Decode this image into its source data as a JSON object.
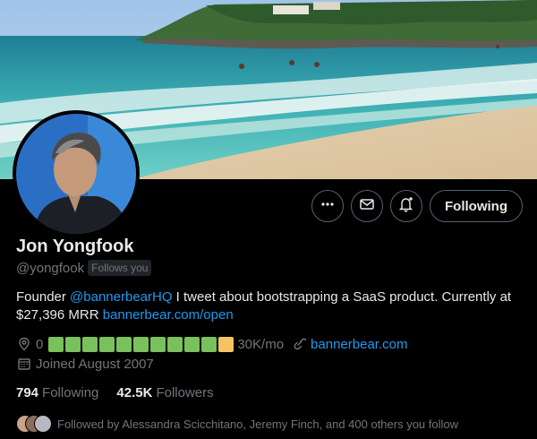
{
  "profile": {
    "name": "Jon Yongfook",
    "handle": "@yongfook",
    "follows_you_badge": "Follows you",
    "bio": {
      "part1": "Founder ",
      "mention": "@bannerbearHQ",
      "part2": " I tweet about bootstrapping a SaaS product. Currently at $27,396 MRR ",
      "link": "bannerbear.com/open"
    },
    "location": "0",
    "progress": {
      "filled_segments": 10,
      "partial_segments": 1,
      "total_segments": 11,
      "label": "30K/mo",
      "filled_color": "#7ac15b",
      "partial_color": "#f5c462"
    },
    "website": "bannerbear.com",
    "joined": "Joined August 2007",
    "following_count": "794",
    "following_label": "Following",
    "followers_count": "42.5K",
    "followers_label": "Followers",
    "followed_by": "Followed by Alessandra Scicchitano, Jeremy Finch, and 400 others you follow"
  },
  "actions": {
    "more_icon": "more-horizontal-icon",
    "message_icon": "envelope-icon",
    "notify_icon": "bell-plus-icon",
    "following_label": "Following"
  },
  "colors": {
    "background": "#000000",
    "text_primary": "#e7e9ea",
    "text_secondary": "#71767b",
    "link": "#1d9bf0",
    "border": "#536471"
  }
}
